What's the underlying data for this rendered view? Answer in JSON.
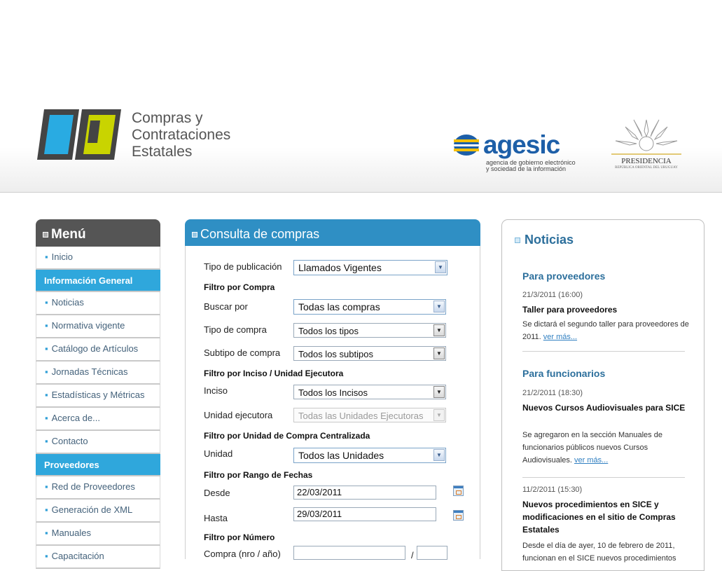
{
  "header": {
    "logo_lines": [
      "Compras y",
      "Contrataciones",
      "Estatales"
    ],
    "agesic_word": "agesic",
    "agesic_tagline": [
      "agencia de gobierno electrónico",
      "y sociedad de la información"
    ],
    "presidencia_label": "PRESIDENCIA",
    "presidencia_sub": "REPÚBLICA ORIENTAL DEL URUGUAY",
    "colors": {
      "logo_blue": "#29abe2",
      "logo_yellow": "#c9d400",
      "logo_dark": "#444444",
      "agesic_blue": "#1d5fa8",
      "agesic_yellow": "#f5c000"
    }
  },
  "menu": {
    "title": "Menú",
    "items": [
      {
        "type": "item",
        "label": "Inicio"
      },
      {
        "type": "section",
        "label": "Información General"
      },
      {
        "type": "item",
        "label": "Noticias"
      },
      {
        "type": "item",
        "label": "Normativa vigente"
      },
      {
        "type": "item",
        "label": "Catálogo de Artículos"
      },
      {
        "type": "item",
        "label": "Jornadas Técnicas"
      },
      {
        "type": "item",
        "label": "Estadísticas y Métricas"
      },
      {
        "type": "item",
        "label": "Acerca de..."
      },
      {
        "type": "item",
        "label": "Contacto"
      },
      {
        "type": "section",
        "label": "Proveedores"
      },
      {
        "type": "item",
        "label": "Red de Proveedores"
      },
      {
        "type": "item",
        "label": "Generación de XML"
      },
      {
        "type": "item",
        "label": "Manuales"
      },
      {
        "type": "item",
        "label": "Capacitación"
      }
    ]
  },
  "consulta": {
    "title": "Consulta de compras",
    "tipo_publicacion": {
      "label": "Tipo de publicación",
      "value": "Llamados Vigentes"
    },
    "filtro_compra": "Filtro por Compra",
    "buscar_por": {
      "label": "Buscar por",
      "value": "Todas las compras"
    },
    "tipo_compra": {
      "label": "Tipo de compra",
      "value": "Todos los tipos"
    },
    "subtipo_compra": {
      "label": "Subtipo de compra",
      "value": "Todos los subtipos"
    },
    "filtro_inciso": "Filtro por Inciso / Unidad Ejecutora",
    "inciso": {
      "label": "Inciso",
      "value": "Todos los Incisos"
    },
    "unidad_ejecutora": {
      "label": "Unidad ejecutora",
      "value": "Todas las Unidades Ejecutoras"
    },
    "filtro_ucc": "Filtro por Unidad de Compra Centralizada",
    "unidad": {
      "label": "Unidad",
      "value": "Todos las Unidades"
    },
    "filtro_fechas": "Filtro por Rango de Fechas",
    "desde": {
      "label": "Desde",
      "value": "22/03/2011"
    },
    "hasta": {
      "label": "Hasta",
      "value": "29/03/2011"
    },
    "filtro_numero": "Filtro por Número",
    "compra_nro": {
      "label": "Compra (nro / año)",
      "separator": "/",
      "nro": "",
      "anio": ""
    }
  },
  "noticias": {
    "title": "Noticias",
    "proveedores_heading": "Para proveedores",
    "n1": {
      "date": "21/3/2011 (16:00)",
      "title": "Taller para proveedores",
      "text": "Se dictará el segundo taller para proveedores de 2011.",
      "link": "ver más..."
    },
    "funcionarios_heading": "Para funcionarios",
    "n2": {
      "date": "21/2/2011 (18:30)",
      "title": "Nuevos Cursos Audiovisuales para SICE",
      "text": "Se agregaron en la sección Manuales de funcionarios públicos nuevos Cursos Audiovisuales.",
      "link": "ver más..."
    },
    "n3": {
      "date": "11/2/2011 (15:30)",
      "title": "Nuevos procedimientos en SICE y modificaciones en el sitio de Compras Estatales",
      "text": "Desde el día de ayer, 10 de febrero de 2011, funcionan en el SICE nuevos procedimientos"
    }
  }
}
